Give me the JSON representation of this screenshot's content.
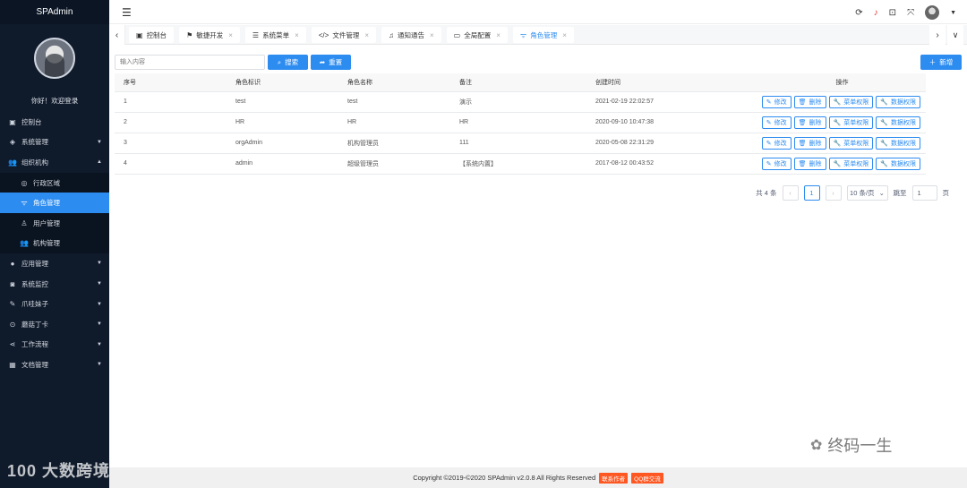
{
  "sidebar": {
    "brand": "SPAdmin",
    "welcome": "你好！欢迎登录",
    "items": [
      {
        "label": "控制台",
        "icon": "monitor-icon",
        "glyph": "▣",
        "caret": ""
      },
      {
        "label": "系统管理",
        "icon": "layers-icon",
        "glyph": "◈",
        "caret": "▼"
      },
      {
        "label": "组织机构",
        "icon": "group-icon",
        "glyph": "👥",
        "caret": "▲"
      },
      {
        "label": "行政区域",
        "icon": "compass-icon",
        "glyph": "◎",
        "caret": ""
      },
      {
        "label": "角色管理",
        "icon": "wifi-icon",
        "glyph": "ᯤ",
        "caret": ""
      },
      {
        "label": "用户管理",
        "icon": "user-icon",
        "glyph": "♙",
        "caret": ""
      },
      {
        "label": "机构管理",
        "icon": "users-icon",
        "glyph": "👥",
        "caret": ""
      },
      {
        "label": "应用管理",
        "icon": "info-icon",
        "glyph": "●",
        "caret": "▼"
      },
      {
        "label": "系统监控",
        "icon": "camera-icon",
        "glyph": "◙",
        "caret": "▼"
      },
      {
        "label": "爪哇妹子",
        "icon": "edit-icon",
        "glyph": "✎",
        "caret": "▼"
      },
      {
        "label": "蘑菇丁卡",
        "icon": "location-icon",
        "glyph": "⊙",
        "caret": "▼"
      },
      {
        "label": "工作流程",
        "icon": "share-icon",
        "glyph": "⋖",
        "caret": "▼"
      },
      {
        "label": "文档管理",
        "icon": "calendar-icon",
        "glyph": "▦",
        "caret": "▼"
      }
    ]
  },
  "topbar": {
    "hamburger": "☰",
    "icons": [
      "refresh-icon",
      "bell-icon",
      "lock-icon",
      "fullscreen-icon"
    ]
  },
  "tabs": {
    "prev": "‹",
    "next": "›",
    "more": "∨",
    "items": [
      {
        "label": "控制台",
        "icon": "monitor-icon",
        "glyph": "▣",
        "close": ""
      },
      {
        "label": "敏捷开发",
        "icon": "flag-icon",
        "glyph": "⚑",
        "close": "×"
      },
      {
        "label": "系统菜单",
        "icon": "list-icon",
        "glyph": "☰",
        "close": "×"
      },
      {
        "label": "文件管理",
        "icon": "code-icon",
        "glyph": "</>",
        "close": "×"
      },
      {
        "label": "通知通告",
        "icon": "bell-icon",
        "glyph": "♫",
        "close": "×"
      },
      {
        "label": "全局配置",
        "icon": "card-icon",
        "glyph": "▭",
        "close": "×"
      },
      {
        "label": "角色管理",
        "icon": "wifi-icon",
        "glyph": "ᯤ",
        "close": "×"
      }
    ]
  },
  "toolbar": {
    "search_placeholder": "输入内容",
    "search_label": "搜索",
    "reset_label": "重置",
    "add_label": "新增"
  },
  "table": {
    "headers": [
      "序号",
      "角色标识",
      "角色名称",
      "备注",
      "创建时间",
      "操作"
    ],
    "rows": [
      {
        "no": "1",
        "code": "test",
        "name": "test",
        "remark": "演示",
        "created": "2021-02-19 22:02:57"
      },
      {
        "no": "2",
        "code": "HR",
        "name": "HR",
        "remark": "HR",
        "created": "2020-09-10 10:47:38"
      },
      {
        "no": "3",
        "code": "orgAdmin",
        "name": "机构管理员",
        "remark": "111",
        "created": "2020-05-08 22:31:29"
      },
      {
        "no": "4",
        "code": "admin",
        "name": "超级管理员",
        "remark": "【系统内置】",
        "created": "2017-08-12 00:43:52"
      }
    ],
    "actions": {
      "edit": "修改",
      "delete": "删除",
      "menu_perm": "菜单权限",
      "data_perm": "数据权限"
    }
  },
  "pager": {
    "total": "共 4 条",
    "prev": "‹",
    "current": "1",
    "next": "›",
    "size": "10 条/页",
    "jump_prefix": "跳至",
    "jump_value": "1",
    "jump_suffix": "页"
  },
  "footer": {
    "copyright": "Copyright ©2019-©2020 SPAdmin v2.0.8 All Rights Reserved",
    "badge1": "联系作者",
    "badge2": "QQ群交流"
  },
  "watermarks": {
    "left": "100 大数跨境",
    "right": "终码一生"
  },
  "colors": {
    "sidebar_bg": "#0f1a2b",
    "accent": "#2d8cf0",
    "badge": "#ff5722"
  }
}
